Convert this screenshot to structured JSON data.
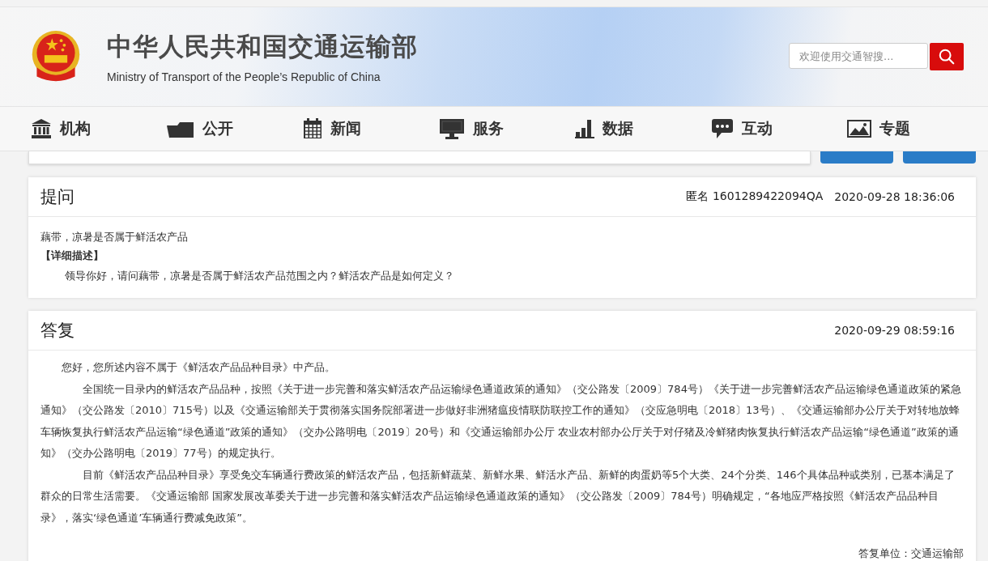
{
  "header": {
    "title": "中华人民共和国交通运输部",
    "subtitle": "Ministry of Transport of the People’s Republic of China",
    "search": {
      "placeholder": "欢迎使用交通智搜..."
    }
  },
  "nav": [
    {
      "label": "机构",
      "kind": "building"
    },
    {
      "label": "公开",
      "kind": "folder"
    },
    {
      "label": "新闻",
      "kind": "calendar"
    },
    {
      "label": "服务",
      "kind": "monitor"
    },
    {
      "label": "数据",
      "kind": "bars"
    },
    {
      "label": "互动",
      "kind": "chat"
    },
    {
      "label": "专题",
      "kind": "image"
    }
  ],
  "question": {
    "heading": "提问",
    "author": "匿名 1601289422094QA",
    "time": "2020-09-28 18:36:06",
    "subject": "藕带，凉暑是否属于鲜活农产品",
    "detail_label": "【详细描述】",
    "detail": "领导你好，请问藕带，凉暑是否属于鲜活农产品范围之内？鲜活农产品是如何定义？"
  },
  "answer": {
    "heading": "答复",
    "time": "2020-09-29 08:59:16",
    "paragraphs": [
      {
        "kind": "short",
        "text": "您好，您所述内容不属于《鲜活农产品品种目录》中产品。"
      },
      {
        "kind": "long",
        "text": "全国统一目录内的鲜活农产品品种，按照《关于进一步完善和落实鲜活农产品运输绿色通道政策的通知》（交公路发〔2009〕784号）《关于进一步完善鲜活农产品运输绿色通道政策的紧急通知》（交公路发〔2010〕715号）以及《交通运输部关于贯彻落实国务院部署进一步做好非洲猪瘟疫情联防联控工作的通知》（交应急明电〔2018〕13号）、《交通运输部办公厅关于对转地放蜂车辆恢复执行鲜活农产品运输“绿色通道”政策的通知》（交办公路明电〔2019〕20号）和《交通运输部办公厅 农业农村部办公厅关于对仔猪及冷鲜猪肉恢复执行鲜活农产品运输“绿色通道”政策的通知》（交办公路明电〔2019〕77号）的规定执行。"
      },
      {
        "kind": "long",
        "text": "目前《鲜活农产品品种目录》享受免交车辆通行费政策的鲜活农产品，包括新鲜蔬菜、新鲜水果、鲜活水产品、新鲜的肉蛋奶等5个大类、24个分类、146个具体品种或类别，已基本满足了群众的日常生活需要。《交通运输部 国家发展改革委关于进一步完善和落实鲜活农产品运输绿色通道政策的通知》（交公路发〔2009〕784号）明确规定，“各地应严格按照《鲜活农产品品种目录》，落实‘绿色通道’车辆通行费减免政策”。"
      }
    ],
    "signature": "答复单位：交通运输部"
  }
}
